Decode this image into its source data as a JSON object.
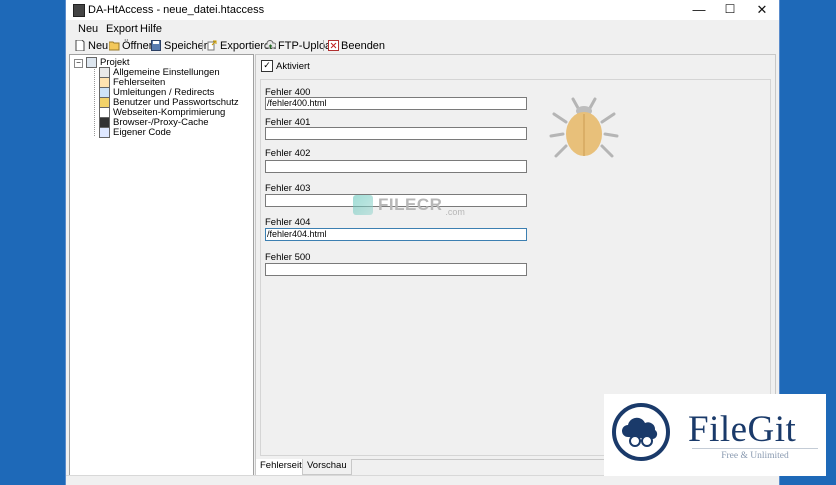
{
  "window": {
    "title": "DA-HtAccess - neue_datei.htaccess",
    "minimize_glyph": "—",
    "maximize_glyph": "☐",
    "close_glyph": "✕"
  },
  "menu": [
    "Neu",
    "Export",
    "Hilfe"
  ],
  "toolbar": {
    "new_label": "Neu",
    "open_label": "Öffnen",
    "save_label": "Speichern",
    "export_label": "Exportieren",
    "ftp_label": "FTP-Upload",
    "exit_label": "Beenden"
  },
  "tree": {
    "expander": "−",
    "root": "Projekt",
    "items": [
      {
        "label": "Allgemeine Einstellungen",
        "icon": "settings-grid-icon"
      },
      {
        "label": "Fehlerseiten",
        "icon": "error-pages-icon"
      },
      {
        "label": "Umleitungen / Redirects",
        "icon": "redirect-icon"
      },
      {
        "label": "Benutzer und Passwortschutz",
        "icon": "lock-icon"
      },
      {
        "label": "Webseiten-Komprimierung",
        "icon": "compress-icon"
      },
      {
        "label": "Browser-/Proxy-Cache",
        "icon": "cache-icon"
      },
      {
        "label": "Eigener Code",
        "icon": "code-icon"
      }
    ]
  },
  "main": {
    "checkbox_label": "Aktiviert",
    "checkbox_mark": "✓",
    "checked": true,
    "fields": [
      {
        "label": "Fehler 400",
        "value": "/fehler400.html"
      },
      {
        "label": "Fehler 401",
        "value": ""
      },
      {
        "label": "Fehler 402",
        "value": ""
      },
      {
        "label": "Fehler 403",
        "value": ""
      },
      {
        "label": "Fehler 404",
        "value": "/fehler404.html"
      },
      {
        "label": "Fehler 500",
        "value": ""
      }
    ]
  },
  "tabs": [
    "Fehlerseiten",
    "Vorschau"
  ],
  "watermark": {
    "text": "FILECR",
    "suffix": ".com"
  },
  "logo": {
    "name": "FileGit",
    "tagline": "Free & Unlimited"
  },
  "colors": {
    "desktop": "#1e69b8",
    "bug_body": "#e8c07a",
    "bug_legs": "#b5b5b5",
    "logo_navy": "#1a3a6a"
  }
}
